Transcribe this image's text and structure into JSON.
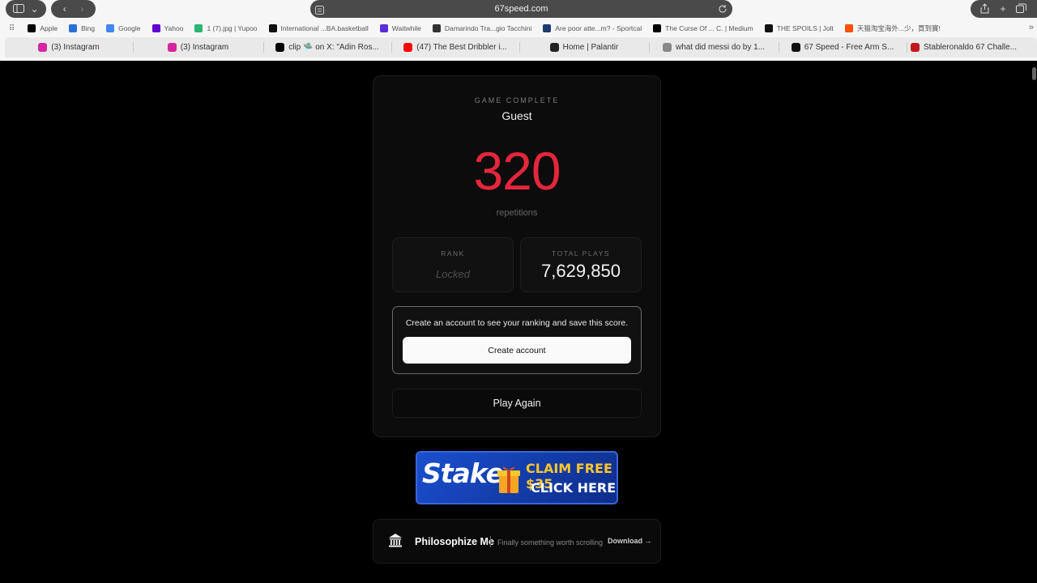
{
  "browser": {
    "url": "67speed.com",
    "bookmarks": [
      {
        "label": "Apple",
        "icon": "apple-icon",
        "color": "#000000"
      },
      {
        "label": "Bing",
        "icon": "search-icon",
        "color": "#2a6fdb"
      },
      {
        "label": "Google",
        "icon": "google-icon",
        "color": "#4285f4"
      },
      {
        "label": "Yahoo",
        "icon": "yahoo-icon",
        "color": "#6001d2"
      },
      {
        "label": "1 (7).jpg | Yupoo",
        "icon": "yupoo-icon",
        "color": "#2bb673"
      },
      {
        "label": "International ...BA.basketball",
        "icon": "fiba-icon",
        "color": "#111111"
      },
      {
        "label": "Waitwhile",
        "icon": "waitwhile-icon",
        "color": "#5b2fd6"
      },
      {
        "label": "Damarindo Tra...gio Tacchini",
        "icon": "tacchini-icon",
        "color": "#333333"
      },
      {
        "label": "Are poor atte...m? - Sportcal",
        "icon": "sportcal-icon",
        "color": "#1d3b6e"
      },
      {
        "label": "The Curse Of ... C. | Medium",
        "icon": "medium-icon",
        "color": "#000000"
      },
      {
        "label": "THE SPOILS | Jolt",
        "icon": "jolt-icon",
        "color": "#111111"
      },
      {
        "label": "天猫淘宝海外...少，買到寶!",
        "icon": "taobao-icon",
        "color": "#ff5000"
      }
    ],
    "tabs": [
      {
        "label": "(3) Instagram",
        "icon": "instagram-icon",
        "color": "#d6249f",
        "width": 158
      },
      {
        "label": "(3) Instagram",
        "icon": "instagram-icon",
        "color": "#d6249f",
        "width": 161
      },
      {
        "label": "clip 🛸 on X: \"Adin Ros...",
        "icon": "x-icon",
        "color": "#000000",
        "width": 158
      },
      {
        "label": "(47) The Best Dribbler i...",
        "icon": "youtube-icon",
        "color": "#ff0000",
        "width": 158
      },
      {
        "label": "Home | Palantir",
        "icon": "palantir-icon",
        "color": "#222222",
        "width": 160
      },
      {
        "label": "what did messi do by 1...",
        "icon": "search-result-icon",
        "color": "#888888",
        "width": 160
      },
      {
        "label": "67 Speed - Free Arm S...",
        "icon": "site-67-icon",
        "color": "#111111",
        "width": 158
      },
      {
        "label": "Stableronaldo 67 Challe...",
        "icon": "tub-icon",
        "color": "#c4161c",
        "width": 141
      }
    ]
  },
  "result": {
    "kicker": "GAME COMPLETE",
    "player": "Guest",
    "score": "320",
    "score_unit": "repetitions",
    "rank_label": "RANK",
    "rank_value": "Locked",
    "plays_label": "TOTAL PLAYS",
    "plays_value": "7,629,850",
    "cta_text": "Create an account to see your ranking and save this score.",
    "cta_button": "Create account",
    "play_again": "Play Again",
    "accent": "#e4263c"
  },
  "ad": {
    "brand": "Stake",
    "line1": "CLAIM FREE $35",
    "line2": "CLICK HERE"
  },
  "promo": {
    "title": "Philosophize Me",
    "tagline": "Finally something worth scrolling",
    "link": "Download →"
  }
}
